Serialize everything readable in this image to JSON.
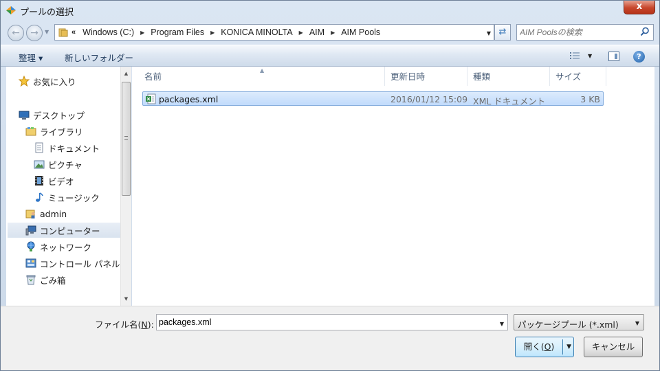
{
  "window": {
    "title": "プールの選択",
    "close_glyph": "x"
  },
  "address": {
    "lead": "«",
    "crumbs": [
      "Windows (C:)",
      "Program Files",
      "KONICA MINOLTA",
      "AIM",
      "AIM Pools"
    ]
  },
  "search": {
    "placeholder": "AIM Poolsの検索"
  },
  "toolbar": {
    "organize_label": "整理 ▾",
    "new_folder_label": "新しいフォルダー",
    "help_label": "?"
  },
  "sidebar": {
    "items": [
      {
        "label": "お気に入り",
        "icon": "star-icon"
      },
      {
        "label": "デスクトップ",
        "icon": "desktop-icon"
      },
      {
        "label": "ライブラリ",
        "icon": "library-icon"
      },
      {
        "label": "ドキュメント",
        "icon": "documents-icon"
      },
      {
        "label": "ピクチャ",
        "icon": "pictures-icon"
      },
      {
        "label": "ビデオ",
        "icon": "video-icon"
      },
      {
        "label": "ミュージック",
        "icon": "music-icon"
      },
      {
        "label": "admin",
        "icon": "user-folder-icon"
      },
      {
        "label": "コンピューター",
        "icon": "computer-icon",
        "selected": true
      },
      {
        "label": "ネットワーク",
        "icon": "network-icon"
      },
      {
        "label": "コントロール パネル",
        "icon": "control-panel-icon"
      },
      {
        "label": "ごみ箱",
        "icon": "recycle-bin-icon"
      }
    ]
  },
  "columns": [
    "名前",
    "更新日時",
    "種類",
    "サイズ"
  ],
  "files": [
    {
      "name": "packages.xml",
      "modified": "2016/01/12 15:09",
      "type": "XML ドキュメント",
      "size": "3 KB",
      "icon": "xml-file-icon",
      "selected": true
    }
  ],
  "footer": {
    "filename_label": "ファイル名(",
    "filename_mnemonic": "N",
    "filename_label_end": "):",
    "filename_value": "packages.xml",
    "filetype_value": "パッケージプール (*.xml)",
    "open_label": "開く(",
    "open_mnemonic": "O",
    "open_label_end": ")",
    "cancel_label": "キャンセル"
  },
  "colors": {
    "selection": "#cce4fc",
    "selection_border": "#84acdd",
    "close_red": "#c7462c"
  }
}
